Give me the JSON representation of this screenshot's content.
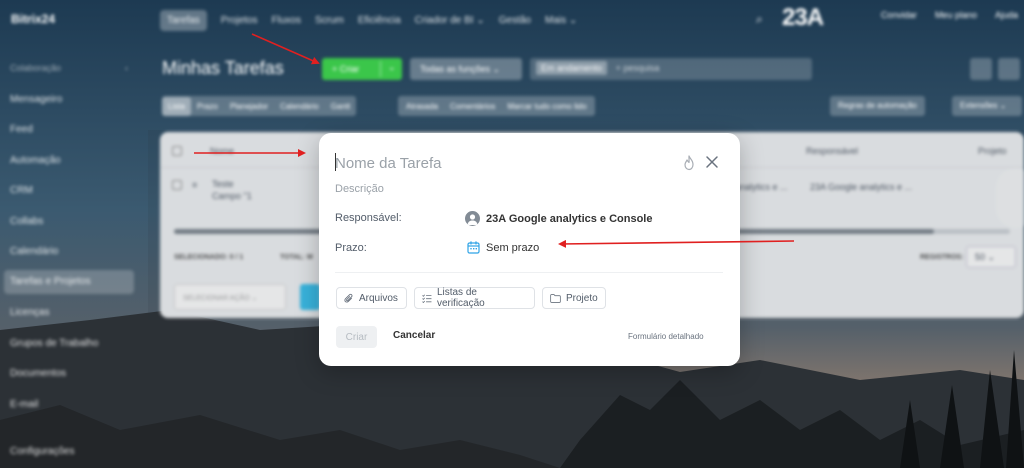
{
  "app": {
    "logo": "Bitrix24",
    "brand": "23A"
  },
  "sidebar": {
    "group_label": "Colaboração",
    "items": [
      {
        "label": "Mensageiro"
      },
      {
        "label": "Feed"
      },
      {
        "label": "Automação"
      },
      {
        "label": "CRM"
      },
      {
        "label": "Collabs"
      },
      {
        "label": "Calendário"
      },
      {
        "label": "Tarefas e Projetos"
      },
      {
        "label": "Licenças"
      },
      {
        "label": "Grupos de Trabalho"
      },
      {
        "label": "Documentos"
      },
      {
        "label": "E-mail"
      },
      {
        "label": "Configurações"
      }
    ]
  },
  "topnav": {
    "items": [
      "Tarefas",
      "Projetos",
      "Fluxos",
      "Scrum",
      "Eficiência",
      "Criador de BI ⌄",
      "Gestão",
      "Mais ⌄"
    ],
    "right": [
      "Convidar",
      "Meu plano",
      "Ajuda"
    ]
  },
  "toolbar": {
    "title": "Minhas Tarefas",
    "create_label": "+ Criar",
    "filter_label": "Todas as funções ⌄",
    "search_tag": "Em andamento",
    "search_placeholder": "+ pesquisa"
  },
  "views": {
    "items": [
      "Lista",
      "Prazo",
      "Planejador",
      "Calendário",
      "Gantt"
    ],
    "counters": [
      "Atrasada",
      "Comentários",
      "Marcar tudo como lido"
    ],
    "automation": "Regras de automação",
    "extensions": "Extensões ⌄"
  },
  "grid": {
    "headers": {
      "name": "Nome",
      "responsible": "Responsável",
      "project": "Projeto"
    },
    "row": {
      "name": "Teste Campo \"1",
      "partial_responsible": "analytics e ...",
      "responsible": "23A Google analytics e ..."
    },
    "footer": {
      "selected": "SELECIONADO: 0 / 1",
      "total": "TOTAL: M",
      "records": "REGISTROS:",
      "per_page": "50 ⌄",
      "bulk_action": "SELECIONAR AÇÃO ⌄"
    }
  },
  "modal": {
    "task_name_placeholder": "Nome da Tarefa",
    "description": "Descrição",
    "responsible_label": "Responsável:",
    "responsible_value": "23A Google analytics e Console",
    "deadline_label": "Prazo:",
    "deadline_value": "Sem prazo",
    "chips": {
      "files": "Arquivos",
      "checklists": "Listas de verificação",
      "project": "Projeto"
    },
    "create_button": "Criar",
    "cancel_button": "Cancelar",
    "detailed_form": "Formulário detalhado"
  },
  "colors": {
    "accent_green": "#3bc64a",
    "brand_yellow": "#f2b01e",
    "annotation_red": "#e02020",
    "calendar_blue": "#2fa3e6"
  }
}
